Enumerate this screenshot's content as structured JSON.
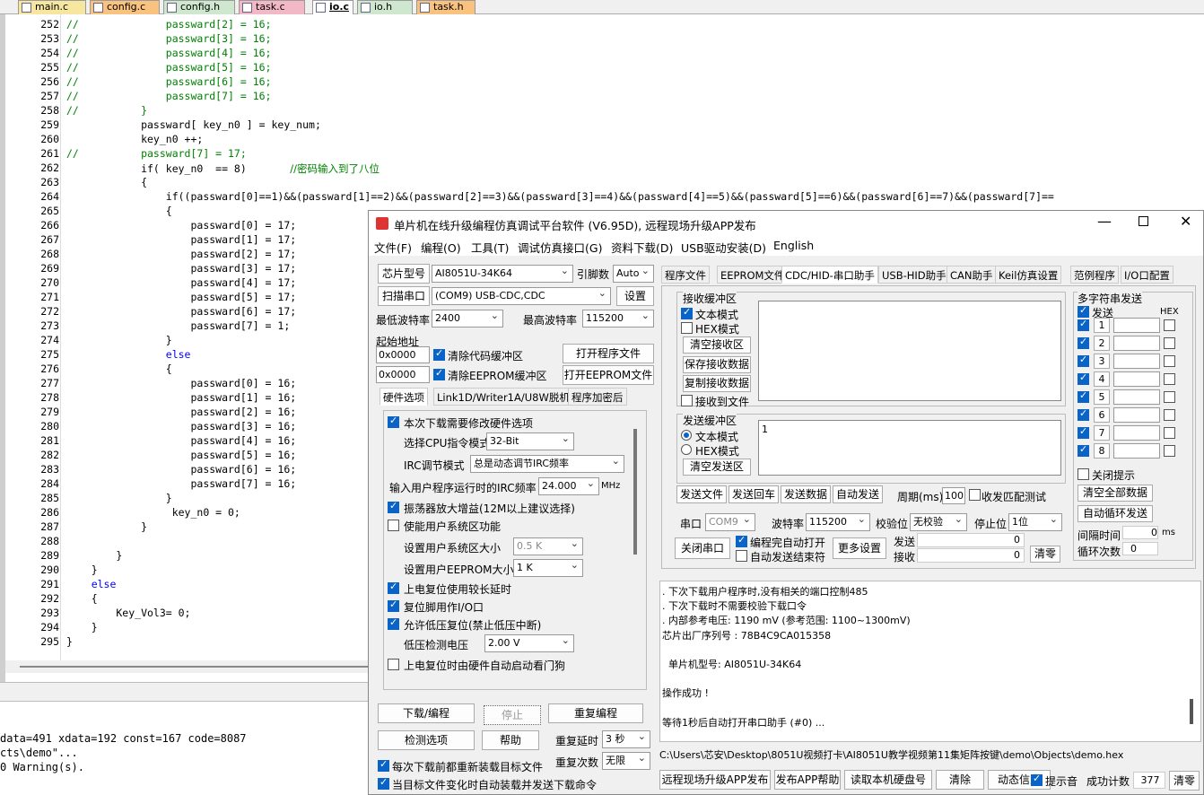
{
  "file_tabs": [
    {
      "label": "main.c",
      "color": "#f7e6a0"
    },
    {
      "label": "config.c",
      "color": "#f9c27e"
    },
    {
      "label": "config.h",
      "color": "#cfe7cf"
    },
    {
      "label": "task.c",
      "color": "#f2b8c6"
    },
    {
      "label": "io.c",
      "color": "#ffffff"
    },
    {
      "label": "io.h",
      "color": "#cfe7cf"
    },
    {
      "label": "task.h",
      "color": "#f9c27e"
    }
  ],
  "code_lines": [
    {
      "n": "252",
      "t": "//              passward[2] = 16;",
      "k": "c"
    },
    {
      "n": "253",
      "t": "//              passward[3] = 16;",
      "k": "c"
    },
    {
      "n": "254",
      "t": "//              passward[4] = 16;",
      "k": "c"
    },
    {
      "n": "255",
      "t": "//              passward[5] = 16;",
      "k": "c"
    },
    {
      "n": "256",
      "t": "//              passward[6] = 16;",
      "k": "c"
    },
    {
      "n": "257",
      "t": "//              passward[7] = 16;",
      "k": "c"
    },
    {
      "n": "258",
      "t": "//          }",
      "k": "c"
    },
    {
      "n": "259",
      "t": "            passward[ key_n0 ] = key_num;",
      "k": "n"
    },
    {
      "n": "260",
      "t": "            key_n0 ++;",
      "k": "n"
    },
    {
      "n": "261",
      "t": "//          passward[7] = 17;",
      "k": "c"
    },
    {
      "n": "262",
      "t": "            if( key_n0  == 8)       ",
      "k": "if",
      "cm": "//密码输入到了八位"
    },
    {
      "n": "263",
      "t": "            {",
      "k": "n"
    },
    {
      "n": "264",
      "t": "                if((passward[0]==1)&&(passward[1]==2)&&(passward[2]==3)&&(passward[3]==4)&&(passward[4]==5)&&(passward[5]==6)&&(passward[6]==7)&&(passward[7]==",
      "k": "if"
    },
    {
      "n": "265",
      "t": "                {",
      "k": "n"
    },
    {
      "n": "266",
      "t": "                    passward[0] = 17;",
      "k": "n"
    },
    {
      "n": "267",
      "t": "                    passward[1] = 17;",
      "k": "n"
    },
    {
      "n": "268",
      "t": "                    passward[2] = 17;",
      "k": "n"
    },
    {
      "n": "269",
      "t": "                    passward[3] = 17;",
      "k": "n"
    },
    {
      "n": "270",
      "t": "                    passward[4] = 17;",
      "k": "n"
    },
    {
      "n": "271",
      "t": "                    passward[5] = 17;",
      "k": "n"
    },
    {
      "n": "272",
      "t": "                    passward[6] = 17;",
      "k": "n"
    },
    {
      "n": "273",
      "t": "                    passward[7] = 1;",
      "k": "n"
    },
    {
      "n": "274",
      "t": "                }",
      "k": "n"
    },
    {
      "n": "275",
      "t": "                else",
      "k": "else"
    },
    {
      "n": "276",
      "t": "                {",
      "k": "n"
    },
    {
      "n": "277",
      "t": "                    passward[0] = 16;",
      "k": "n"
    },
    {
      "n": "278",
      "t": "                    passward[1] = 16;",
      "k": "n"
    },
    {
      "n": "279",
      "t": "                    passward[2] = 16;",
      "k": "n"
    },
    {
      "n": "280",
      "t": "                    passward[3] = 16;",
      "k": "n"
    },
    {
      "n": "281",
      "t": "                    passward[4] = 16;",
      "k": "n"
    },
    {
      "n": "282",
      "t": "                    passward[5] = 16;",
      "k": "n"
    },
    {
      "n": "283",
      "t": "                    passward[6] = 16;",
      "k": "n"
    },
    {
      "n": "284",
      "t": "                    passward[7] = 16;",
      "k": "n"
    },
    {
      "n": "285",
      "t": "                }",
      "k": "n"
    },
    {
      "n": "286",
      "t": "                 key_n0 = 0;",
      "k": "n"
    },
    {
      "n": "287",
      "t": "            }",
      "k": "n"
    },
    {
      "n": "288",
      "t": "",
      "k": "n"
    },
    {
      "n": "289",
      "t": "        }",
      "k": "n"
    },
    {
      "n": "290",
      "t": "    }",
      "k": "n"
    },
    {
      "n": "291",
      "t": "    else",
      "k": "else"
    },
    {
      "n": "292",
      "t": "    {",
      "k": "n"
    },
    {
      "n": "293",
      "t": "        Key_Vol3= 0;",
      "k": "n"
    },
    {
      "n": "294",
      "t": "    }",
      "k": "n"
    },
    {
      "n": "295",
      "t": "}",
      "k": "n"
    }
  ],
  "build_output": [
    "data=491 xdata=192 const=167 code=8087",
    "cts\\demo\"...",
    "0 Warning(s)."
  ],
  "dialog": {
    "title": "单片机在线升级编程仿真调试平台软件 (V6.95D), 远程现场升级APP发布",
    "menu": [
      "文件(F)",
      "编程(O)",
      "工具(T)",
      "调试仿真接口(G)",
      "资料下载(D)",
      "USB驱动安装(D)",
      "English"
    ],
    "chip_label": "芯片型号",
    "chip_value": "AI8051U-34K64",
    "pins_label": "引脚数",
    "pins_value": "Auto",
    "scan_label": "扫描串口",
    "port_value": "(COM9) USB-CDC,CDC",
    "settings_btn": "设置",
    "min_baud_label": "最低波特率",
    "min_baud": "2400",
    "max_baud_label": "最高波特率",
    "max_baud": "115200",
    "start_addr_label": "起始地址",
    "addr1": "0x0000",
    "clear_code": "清除代码缓冲区",
    "open_prog": "打开程序文件",
    "addr2": "0x0000",
    "clear_eeprom": "清除EEPROM缓冲区",
    "open_eeprom": "打开EEPROM文件",
    "left_tabs": [
      "硬件选项",
      "Link1D/Writer1A/U8W脱机",
      "程序加密后"
    ],
    "hw_opts": {
      "o1": "本次下载需要修改硬件选项",
      "cpu_mode_label": "选择CPU指令模式",
      "cpu_mode": "32-Bit",
      "irc_label": "IRC调节模式",
      "irc_value": "总是动态调节IRC频率",
      "freq_label": "输入用户程序运行时的IRC频率",
      "freq_value": "24.000",
      "freq_unit": "MHz",
      "o2": "振荡器放大增益(12M以上建议选择)",
      "o3": "使能用户系统区功能",
      "sys_size_label": "设置用户系统区大小",
      "sys_size": "0.5 K",
      "eeprom_size_label": "设置用户EEPROM大小",
      "eeprom_size": "1  K",
      "o4": "上电复位使用较长延时",
      "o5": "复位脚用作I/O口",
      "o6": "允许低压复位(禁止低压中断)",
      "lv_label": "低压检测电压",
      "lv_value": "2.00 V",
      "o7": "上电复位时由硬件自动启动看门狗"
    },
    "btn_download": "下载/编程",
    "btn_stop": "停止",
    "btn_reprog": "重复编程",
    "btn_check": "检测选项",
    "btn_help": "帮助",
    "repeat_delay_label": "重复延时",
    "repeat_delay": "3 秒",
    "repeat_count_label": "重复次数",
    "repeat_count": "无限",
    "chk_reload": "每次下载前都重新装载目标文件",
    "chk_autosend": "当目标文件变化时自动装载并发送下载命令",
    "right_tabs": [
      "程序文件",
      "EEPROM文件",
      "CDC/HID-串口助手",
      "USB-HID助手",
      "CAN助手",
      "Keil仿真设置",
      "范例程序",
      "I/O口配置"
    ],
    "recv_group": "接收缓冲区",
    "text_mode": "文本模式",
    "hex_mode": "HEX模式",
    "clear_recv": "清空接收区",
    "save_recv": "保存接收数据",
    "copy_recv": "复制接收数据",
    "recv_to_file": "接收到文件",
    "send_group": "发送缓冲区",
    "send_text": "1",
    "clear_send": "清空发送区",
    "send_btns": [
      "发送文件",
      "发送回车",
      "发送数据",
      "自动发送"
    ],
    "period_label": "周期(ms)",
    "period_value": "100",
    "match_test": "收发匹配测试",
    "port_label": "串口",
    "port_sel": "COM9",
    "baud_label": "波特率",
    "baud_value": "115200",
    "parity_label": "校验位",
    "parity_value": "无校验",
    "stop_label": "停止位",
    "stop_value": "1位",
    "close_port": "关闭串口",
    "auto_open": "编程完自动打开",
    "auto_send_end": "自动发送结束符",
    "more_settings": "更多设置",
    "tx_label": "发送",
    "tx_count": "0",
    "rx_label": "接收",
    "rx_count": "0",
    "clear_count": "清零",
    "multi_title": "多字符串发送",
    "multi_send": "发送",
    "multi_hex": "HEX",
    "multi_items": [
      "1",
      "2",
      "3",
      "4",
      "5",
      "6",
      "7",
      "8"
    ],
    "close_hint": "关闭提示",
    "clear_all": "清空全部数据",
    "auto_loop": "自动循环发送",
    "interval_label": "间隔时间",
    "interval_value": "0",
    "interval_unit": "ms",
    "loop_label": "循环次数",
    "loop_value": "0",
    "log": [
      ". 下次下载用户程序时,没有相关的端口控制485",
      ". 下次下载时不需要校验下载口令",
      ". 内部参考电压: 1190 mV (参考范围: 1100~1300mV)",
      "芯片出厂序列号 : 78B4C9CA015358",
      "",
      "  单片机型号: AI8051U-34K64",
      "",
      "操作成功 !",
      "",
      "等待1秒后自动打开串口助手 (#0) ..."
    ],
    "path": "C:\\Users\\芯安\\Desktop\\8051U视频打卡\\AI8051U教学视频第11集矩阵按键\\demo\\Objects\\demo.hex",
    "bottom_btns": [
      "远程现场升级APP发布",
      "发布APP帮助",
      "读取本机硬盘号",
      "清除",
      "动态信息"
    ],
    "tip_label": "提示音",
    "success_label": "成功计数",
    "success_count": "377",
    "clear_btn": "清零"
  }
}
